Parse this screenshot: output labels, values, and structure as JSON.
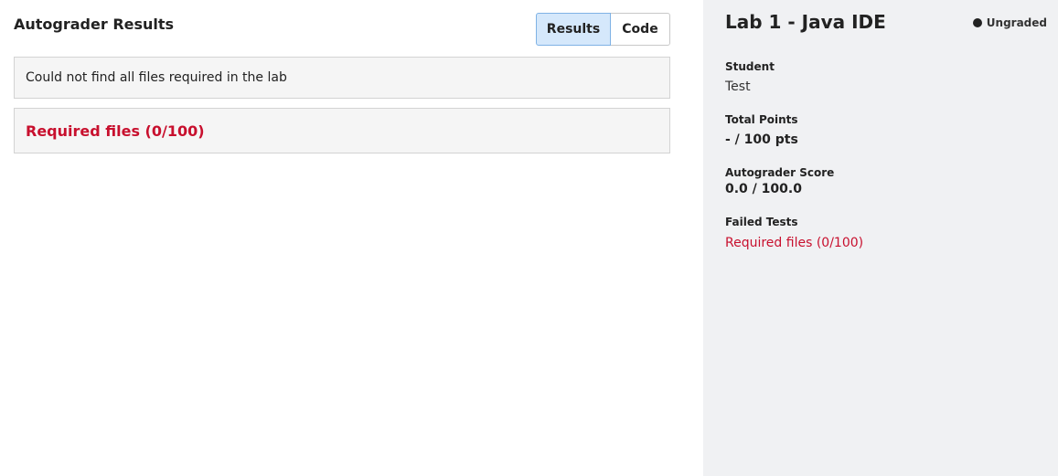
{
  "main": {
    "title": "Autograder Results",
    "toggle": {
      "results_label": "Results",
      "code_label": "Code"
    },
    "message": "Could not find all files required in the lab",
    "tests": [
      {
        "label": "Required files (0/100)"
      }
    ]
  },
  "sidebar": {
    "title": "Lab 1 - Java IDE",
    "status": "Ungraded",
    "student_label": "Student",
    "student_value": "Test",
    "total_points_label": "Total Points",
    "total_points_value": "- / 100 pts",
    "autograder_score_label": "Autograder Score",
    "autograder_score_value": "0.0 / 100.0",
    "failed_tests_label": "Failed Tests",
    "failed_tests": [
      "Required files (0/100)"
    ]
  },
  "colors": {
    "accent_active": "#d5e8fb",
    "failure_red": "#c8102e",
    "sidebar_bg": "#f0f1f3"
  }
}
